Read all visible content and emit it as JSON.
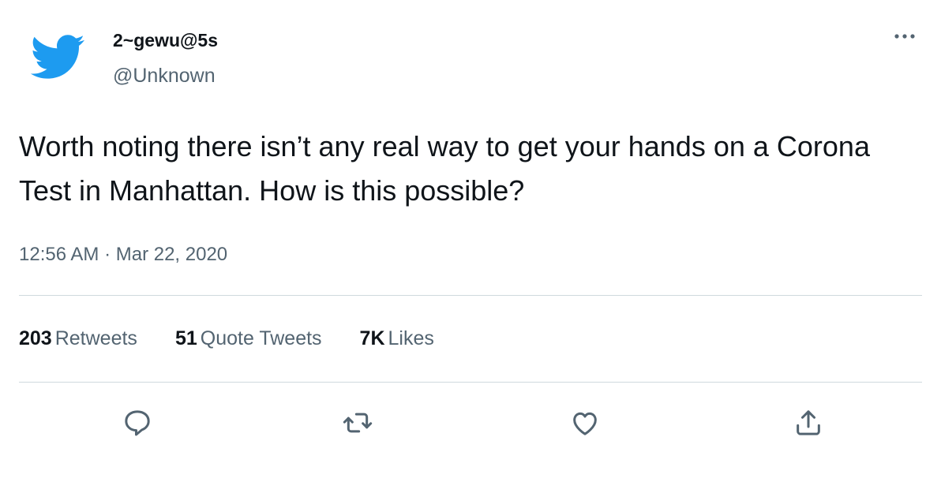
{
  "brand": {
    "logo_icon": "twitter-bird-icon",
    "logo_color": "#1d9bf0"
  },
  "author": {
    "display_name": "2~gewu@5s",
    "handle": "@Unknown"
  },
  "more_icon": "more-dots-icon",
  "tweet": {
    "text": "Worth noting there isn’t any real way to get your hands on a Corona Test in Manhattan. How is this possible?",
    "timestamp": "12:56 AM · Mar 22, 2020"
  },
  "stats": {
    "retweets_count": "203",
    "retweets_label": "Retweets",
    "quotes_count": "51",
    "quotes_label": "Quote Tweets",
    "likes_count": "7K",
    "likes_label": "Likes"
  },
  "actions": [
    {
      "icon": "reply-icon"
    },
    {
      "icon": "retweet-icon"
    },
    {
      "icon": "like-icon"
    },
    {
      "icon": "share-icon"
    }
  ],
  "colors": {
    "text_primary": "#0f1419",
    "text_secondary": "#536471",
    "divider": "#cfd9de",
    "accent": "#1d9bf0"
  }
}
